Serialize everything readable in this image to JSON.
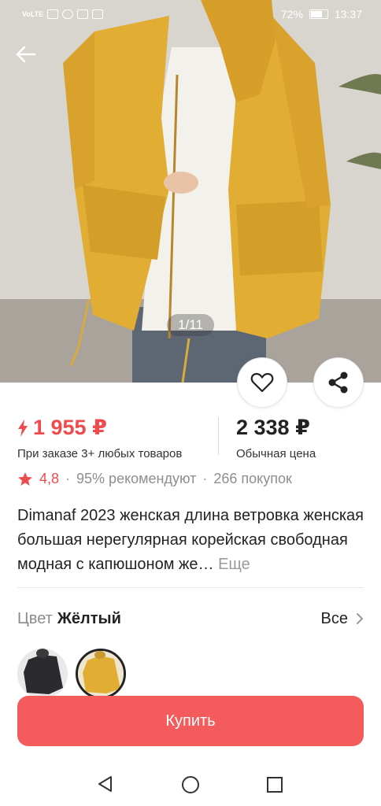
{
  "status_bar": {
    "left_text": "VoLTE",
    "battery": "72%",
    "battery_level": 0.72,
    "time": "13:37"
  },
  "gallery": {
    "counter": "1/11"
  },
  "price": {
    "sale": "1 955 ₽",
    "sale_note": "При заказе 3+ любых товаров",
    "regular": "2 338 ₽",
    "regular_note": "Обычная цена"
  },
  "rating": {
    "value": "4,8",
    "recommend": "95% рекомендуют",
    "purchases": "266 покупок"
  },
  "product": {
    "title": "Dimanaf 2023 женская длина ветровка женская большая нерегулярная корейская свободная модная с капюшоном же…",
    "more": "Еще"
  },
  "color": {
    "label": "Цвет",
    "selected": "Жёлтый",
    "all": "Все"
  },
  "actions": {
    "buy": "Купить"
  },
  "colors": {
    "accent": "#f35b5c",
    "price_red": "#ef4b4f",
    "jacket": "#e2ad33"
  }
}
